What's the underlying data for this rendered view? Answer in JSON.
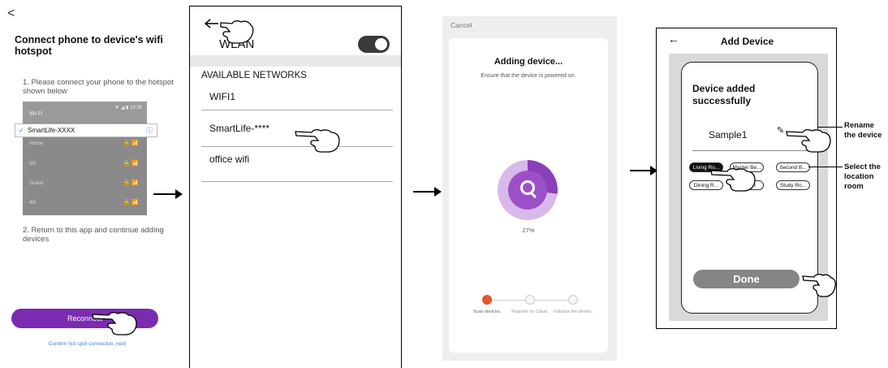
{
  "panel1": {
    "back_glyph": "<",
    "title": "Connect phone to device's wifi hotspot",
    "step1": "1. Please connect your phone to the hotspot shown below",
    "wifi_header": "Wi-Fi",
    "status_bar": "▼ ◢ ▮ 10:30",
    "selected_network": "SmartLife-XXXX",
    "networks": [
      "Home",
      "5G",
      "Guest",
      "4G"
    ],
    "step2": "2. Return to this app and continue adding devices",
    "button": "Reconnect",
    "link": "Confirm hot spot connecton, next"
  },
  "panel2": {
    "back_glyph": "←",
    "wlan_label": "WLAN",
    "section_header": "AVAILABLE NETWORKS",
    "networks": [
      "WIFI1",
      "SmartLife-****",
      "office wifi"
    ]
  },
  "panel3": {
    "cancel": "Cancel",
    "title": "Adding device...",
    "subtitle": "Ensure that the device is powered on.",
    "progress_percent": "27%",
    "progress_fraction": 0.27,
    "steps": [
      "Scan devices.",
      "Register on Cloud.",
      "Initialize the device."
    ],
    "active_color": "#e2572b",
    "accent_color": "#8b3fb8"
  },
  "panel4": {
    "back_glyph": "←",
    "header": "Add Device",
    "success": "Device added successfully",
    "device_name": "Sample1",
    "rooms": [
      "Living Ro...",
      "Master Be...",
      "Second B...",
      "Dining R...",
      "Kitchen",
      "Study Ro..."
    ],
    "done": "Done",
    "callout_rename": "Rename the device",
    "callout_room": "Select the location room"
  }
}
